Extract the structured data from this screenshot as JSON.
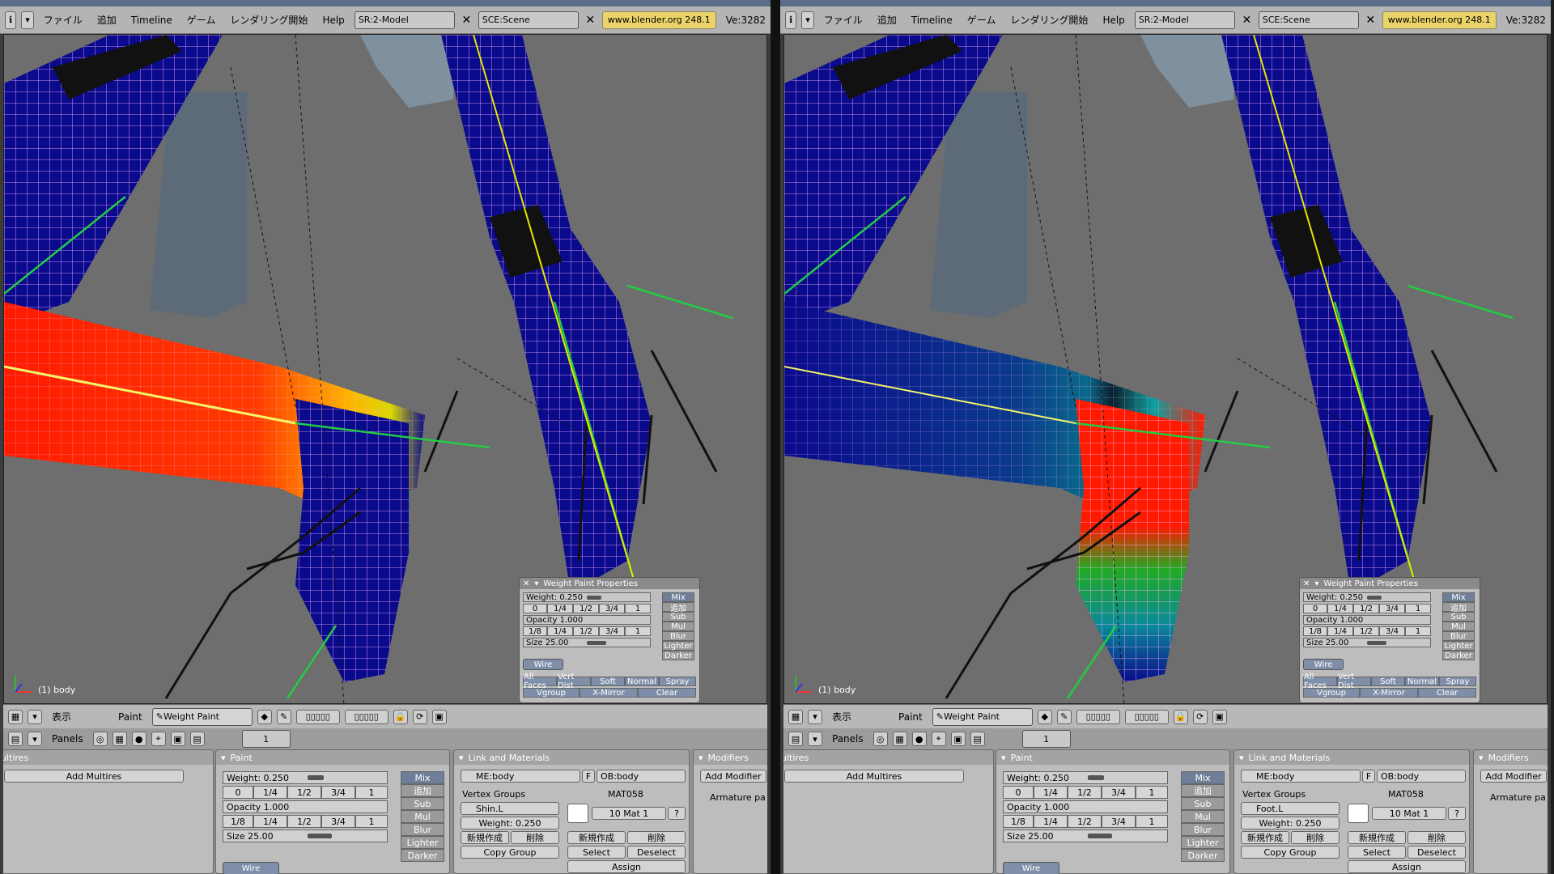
{
  "menu": {
    "items": [
      "ファイル",
      "追加",
      "Timeline",
      "ゲーム",
      "レンダリング開始",
      "Help"
    ],
    "screen_field": "SR:2-Model",
    "scene_field": "SCE:Scene",
    "url": "www.blender.org 248.1",
    "version": "Ve:3282"
  },
  "viewport": {
    "object_label": "(1) body"
  },
  "wpp": {
    "title": "Weight Paint Properties",
    "weight": "Weight: 0.250",
    "weight_presets": [
      "0",
      "1/4",
      "1/2",
      "3/4",
      "1"
    ],
    "opacity": "Opacity 1.000",
    "opacity_presets": [
      "1/8",
      "1/4",
      "1/2",
      "3/4",
      "1"
    ],
    "size": "Size 25.00",
    "blend_modes": [
      "Mix",
      "追加",
      "Sub",
      "Mul",
      "Blur",
      "Lighter",
      "Darker"
    ],
    "wire": "Wire",
    "opt_row1": [
      "All Faces",
      "Vert Dist",
      "Soft",
      "Normal",
      "Spray"
    ],
    "opt_row2": [
      "Vgroup",
      "X-Mirror",
      "Clear"
    ]
  },
  "modebar": {
    "view_menu": "表示",
    "paint_menu": "Paint",
    "mode": "Weight Paint"
  },
  "btnbar": {
    "panels_label": "Panels",
    "frame": "1"
  },
  "panels": {
    "multires": {
      "title": "ultires",
      "add": "Add Multires"
    },
    "paint": {
      "title": "Paint",
      "wire": "Wire"
    },
    "link": {
      "title": "Link and Materials",
      "me": "ME:body",
      "f": "F",
      "ob": "OB:body",
      "vgroups_label": "Vertex Groups",
      "material": "MAT058",
      "group_weight": "Weight: 0.250",
      "new": "新規作成",
      "delete": "削除",
      "copy_group": "Copy Group",
      "mat_slot": "10 Mat 1",
      "q": "?",
      "select": "Select",
      "deselect": "Deselect",
      "assign": "Assign"
    },
    "modifiers": {
      "title": "Modifiers",
      "add": "Add Modifier",
      "armature": "Armature pa"
    }
  },
  "windows": [
    {
      "vertex_group": "Shin.L"
    },
    {
      "vertex_group": "Foot.L"
    }
  ],
  "colors": {
    "accent": "#6f7f9a",
    "url_bg": "#ead46a",
    "mesh_blue": "#0a0a8c",
    "wire": "#ffb4ff"
  }
}
